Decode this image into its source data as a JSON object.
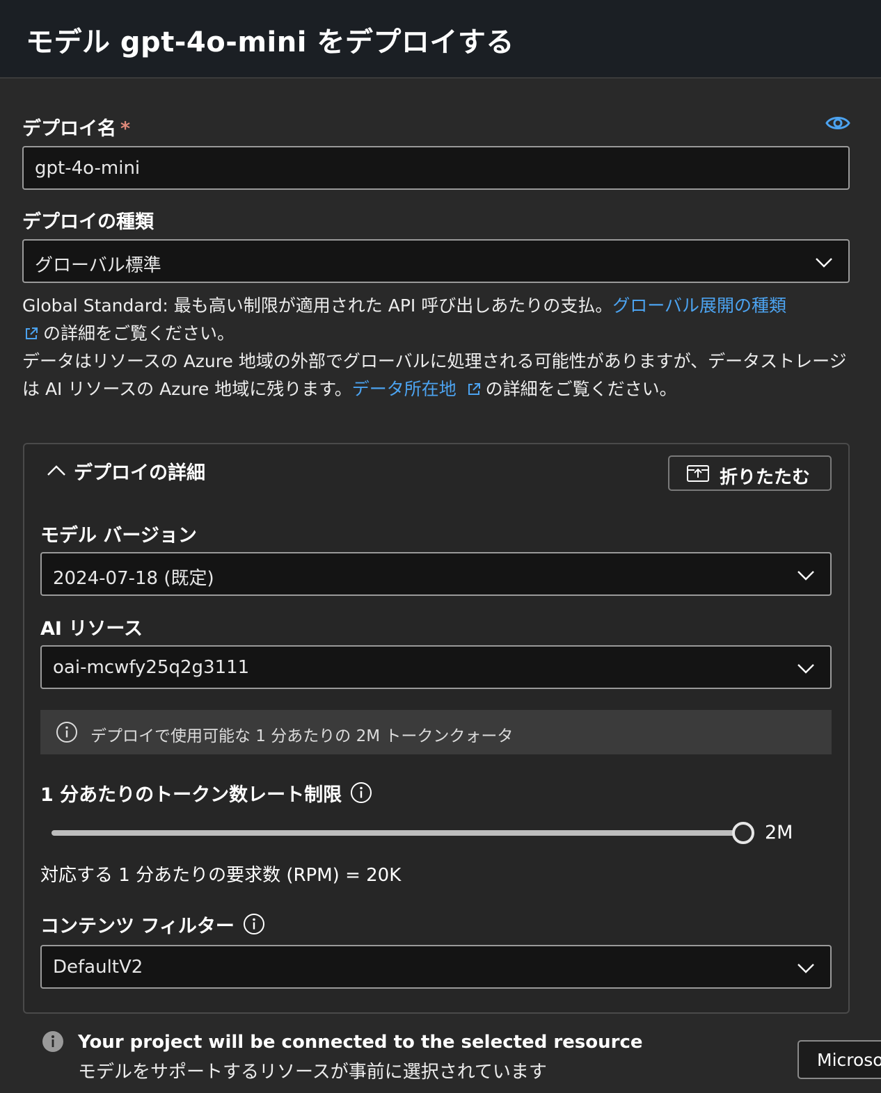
{
  "header": {
    "title": "モデル gpt-4o-mini をデプロイする"
  },
  "deployment_name": {
    "label": "デプロイ名",
    "required_mark": "*",
    "value": "gpt-4o-mini"
  },
  "deployment_type": {
    "label": "デプロイの種類",
    "selected": "グローバル標準"
  },
  "description": {
    "line1_text": "Global Standard: 最も高い制限が適用された API 呼び出しあたりの支払。",
    "line1_link": "グローバル展開の種類",
    "line1_suffix": "の詳細をご覧ください。",
    "line2_text": "データはリソースの Azure 地域の外部でグローバルに処理される可能性がありますが、データストレージは AI リソースの Azure 地域に残ります。",
    "line2_link": "データ所在地",
    "line2_suffix": "の詳細をご覧ください。"
  },
  "details_panel": {
    "title": "デプロイの詳細",
    "collapse_label": "折りたたむ",
    "model_version": {
      "label": "モデル バージョン",
      "selected": "2024-07-18 (既定)"
    },
    "ai_resource": {
      "label": "AI リソース",
      "selected": "oai-mcwfy25q2g3111"
    },
    "quota_info": "デプロイで使用可能な 1 分あたりの 2M トークンクォータ",
    "rate_limit": {
      "label": "1 分あたりのトークン数レート制限",
      "value_label": "2M",
      "slider_fraction": 1.0
    },
    "rpm_text": "対応する 1 分あたりの要求数 (RPM) = 20K",
    "content_filter": {
      "label": "コンテンツ フィルター",
      "selected": "DefaultV2"
    }
  },
  "footer": {
    "title": "Your project will be connected to the selected resource",
    "subtitle": "モデルをサポートするリソースが事前に選択されています",
    "button_label": "Microsoft"
  },
  "colors": {
    "link": "#4ca3f0",
    "background": "#292929",
    "header_bg": "#1b1f24",
    "field_bg": "#141414"
  }
}
